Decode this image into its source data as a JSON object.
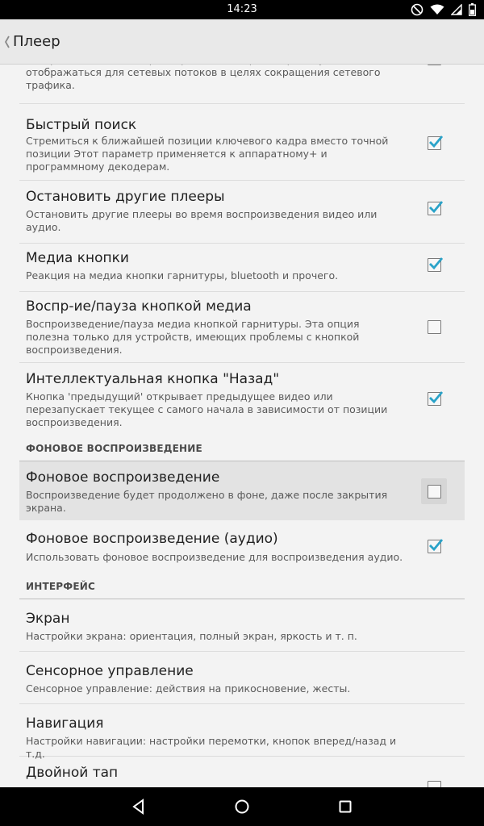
{
  "status_bar": {
    "time": "14:23"
  },
  "action_bar": {
    "title": "Плеер"
  },
  "top_partial": {
    "summary": "воспроизведения. Но предварительный просмотр не будет отображаться для сетевых потоков в целях сокращения сетевого трафика.",
    "checked": true
  },
  "prefs": [
    {
      "title": "Быстрый поиск",
      "summary": "Стремиться к ближайшей позиции ключевого кадра вместо точной позиции Этот параметр применяется к аппаратному+ и программному декодерам.",
      "checked": true
    },
    {
      "title": "Остановить другие плееры",
      "summary": "Остановить другие плееры во время воспроизведения видео или аудио.",
      "checked": true
    },
    {
      "title": "Медиа кнопки",
      "summary": "Реакция на медиа кнопки гарнитуры, bluetooth и прочего.",
      "checked": true
    },
    {
      "title": "Воспр-ие/пауза кнопкой медиа",
      "summary": "Воспроизведение/пауза медиа кнопкой гарнитуры. Эта опция полезна только для устройств, имеющих проблемы с кнопкой воспроизведения.",
      "checked": false
    },
    {
      "title": "Интеллектуальная кнопка \"Назад\"",
      "summary": "Кнопка 'предыдущий' открывает предыдущее видео или перезапускает текущее с самого начала в зависимости от позиции воспроизведения.",
      "checked": true
    }
  ],
  "section_background": {
    "header": "ФОНОВОЕ ВОСПРОИЗВЕДЕНИЕ"
  },
  "background_prefs": [
    {
      "title": "Фоновое воспроизведение",
      "summary": "Воспроизведение будет продолжено в фоне, даже после закрытия экрана.",
      "checked": false
    },
    {
      "title": "Фоновое воспроизведение (аудио)",
      "summary": "Использовать фоновое воспроизведение для воспроизведения аудио.",
      "checked": true
    }
  ],
  "section_interface": {
    "header": "ИНТЕРФЕЙС"
  },
  "interface_prefs": [
    {
      "title": "Экран",
      "summary": "Настройки экрана: ориентация, полный экран, яркость и т. п."
    },
    {
      "title": "Сенсорное управление",
      "summary": "Сенсорное управление: действия на прикосновение, жесты."
    },
    {
      "title": "Навигация",
      "summary": "Настройки навигации: настройки перемотки, кнопок вперед/назад и т.д."
    },
    {
      "title": "Двойной тап",
      "checked": false
    }
  ],
  "colors": {
    "check": "#2aa3c9",
    "status_bar": "#000000",
    "action_bar": "#e9e9e9",
    "background": "#f3f3f3"
  },
  "icons": [
    "do-not-disturb-icon",
    "wifi-icon",
    "signal-icon",
    "battery-icon",
    "back-chevron-icon",
    "nav-back-icon",
    "nav-home-icon",
    "nav-recents-icon"
  ]
}
